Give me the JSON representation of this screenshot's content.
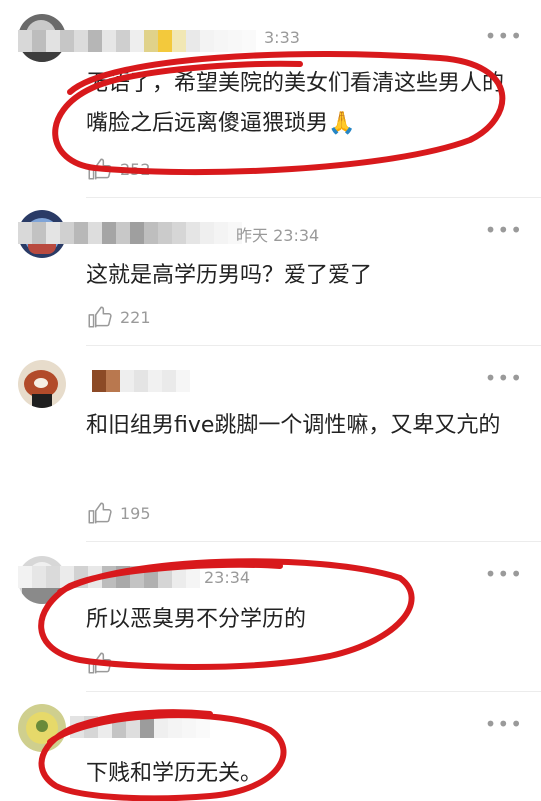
{
  "comments": [
    {
      "time": "3:33",
      "text": "无语了，希望美院的美女们看清这些男人的嘴脸之后远离傻逼猥琐男🙏",
      "likes": "252",
      "more_icon": "more-dots-icon"
    },
    {
      "time": "昨天 23:34",
      "text": "这就是高学历男吗？爱了爱了",
      "likes": "221",
      "more_icon": "more-dots-icon"
    },
    {
      "time": "",
      "text": "和旧组男five跳脚一个调性嘛，又卑又亢的",
      "likes": "195",
      "more_icon": "more-dots-icon"
    },
    {
      "time": "23:34",
      "text": "所以恶臭男不分学历的",
      "likes": "",
      "more_icon": "more-dots-icon"
    },
    {
      "time": "",
      "text": "下贱和学历无关。",
      "likes": "",
      "more_icon": "more-dots-icon"
    }
  ],
  "colors": {
    "annotation_red": "#d8191c",
    "meta_gray": "#9a9a9a"
  }
}
